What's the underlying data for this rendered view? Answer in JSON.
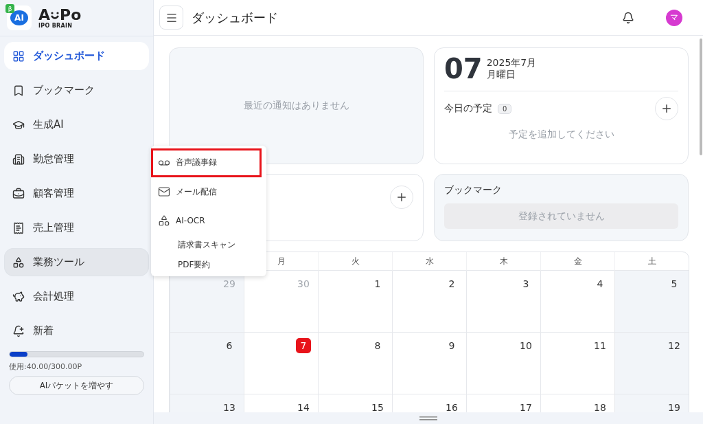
{
  "logo": {
    "badge": "β",
    "mark": "AI",
    "name_left": "A",
    "name_right": "Po",
    "subtitle": "IPO BRAIN"
  },
  "sidebar": {
    "items": [
      {
        "label": "ダッシュボード",
        "selected": true,
        "expanded": false
      },
      {
        "label": "ブックマーク",
        "selected": false,
        "expanded": false
      },
      {
        "label": "生成AI",
        "selected": false,
        "expanded": false
      },
      {
        "label": "勤怠管理",
        "selected": false,
        "expanded": false
      },
      {
        "label": "顧客管理",
        "selected": false,
        "expanded": false
      },
      {
        "label": "売上管理",
        "selected": false,
        "expanded": false
      },
      {
        "label": "業務ツール",
        "selected": false,
        "expanded": true
      },
      {
        "label": "会計処理",
        "selected": false,
        "expanded": false
      },
      {
        "label": "新着",
        "selected": false,
        "expanded": false
      }
    ],
    "usage": {
      "level": 0.133,
      "text": "使用:40.00/300.00P"
    },
    "button": "AIパケットを増やす"
  },
  "header": {
    "title": "ダッシュボード",
    "avatar": "マ"
  },
  "notifications": {
    "empty_text": "最近の通知はありません"
  },
  "today": {
    "day": "07",
    "month": "2025年7月",
    "weekday": "月曜日",
    "schedule_title": "今日の予定",
    "count": "0",
    "empty_text": "予定を追加してください"
  },
  "bookmarks": {
    "title": "ブックマーク",
    "empty_text": "登録されていません"
  },
  "menu": {
    "items": [
      {
        "kind": "item",
        "label": "音声議事録",
        "highlighted": true
      },
      {
        "kind": "item",
        "label": "メール配信",
        "highlighted": false
      },
      {
        "kind": "item",
        "label": "AI-OCR",
        "highlighted": false
      },
      {
        "kind": "sub",
        "label": "請求書スキャン",
        "highlighted": false
      },
      {
        "kind": "sub",
        "label": "PDF要約",
        "highlighted": false
      }
    ]
  },
  "calendar": {
    "weekdays": [
      "月",
      "火",
      "水",
      "木",
      "金",
      "土"
    ],
    "weeks": [
      [
        {
          "day": "29",
          "muted": true,
          "today": false
        },
        {
          "day": "30",
          "muted": true,
          "today": false
        },
        {
          "day": "1",
          "muted": false,
          "today": false
        },
        {
          "day": "2",
          "muted": false,
          "today": false
        },
        {
          "day": "3",
          "muted": false,
          "today": false
        },
        {
          "day": "4",
          "muted": false,
          "today": false
        },
        {
          "day": "5",
          "muted": false,
          "today": false
        }
      ],
      [
        {
          "day": "6",
          "muted": false,
          "today": false
        },
        {
          "day": "7",
          "muted": false,
          "today": true
        },
        {
          "day": "8",
          "muted": false,
          "today": false
        },
        {
          "day": "9",
          "muted": false,
          "today": false
        },
        {
          "day": "10",
          "muted": false,
          "today": false
        },
        {
          "day": "11",
          "muted": false,
          "today": false
        },
        {
          "day": "12",
          "muted": false,
          "today": false
        }
      ],
      [
        {
          "day": "13",
          "muted": false,
          "today": false
        },
        {
          "day": "14",
          "muted": false,
          "today": false
        },
        {
          "day": "15",
          "muted": false,
          "today": false
        },
        {
          "day": "16",
          "muted": false,
          "today": false
        },
        {
          "day": "17",
          "muted": false,
          "today": false
        },
        {
          "day": "18",
          "muted": false,
          "today": false
        },
        {
          "day": "19",
          "muted": false,
          "today": false
        }
      ]
    ]
  }
}
